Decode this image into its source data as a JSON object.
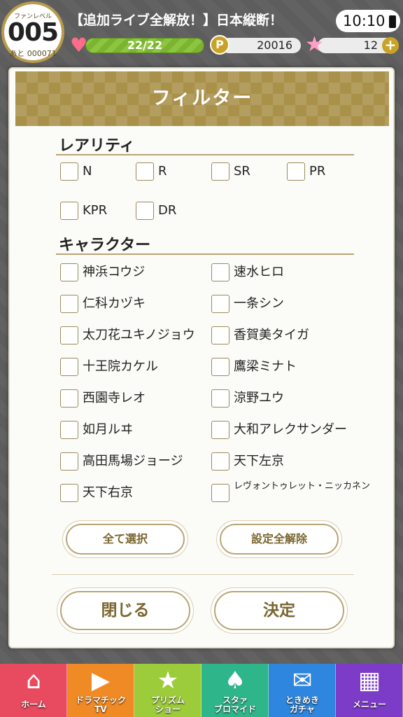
{
  "status_bar": {
    "fan_level_caption": "ファンレベル",
    "fan_level": "005",
    "next_level_remaining": "あと 000071",
    "news_ticker": "【追加ライブ全解放！】日本縦断！",
    "time": "10:10",
    "stamina": "22/22",
    "coins": "20016",
    "stars": "12",
    "coin_icon_letter": "P",
    "icons": {
      "stamina": "heart-icon",
      "coin": "coin-icon",
      "star": "star-icon",
      "add": "plus-icon",
      "battery": "battery-icon"
    }
  },
  "dialog": {
    "title": "フィルター",
    "rarity_section": {
      "title": "レアリティ",
      "options": [
        "N",
        "R",
        "SR",
        "PR",
        "KPR",
        "DR"
      ]
    },
    "character_section": {
      "title": "キャラクター",
      "left_column": [
        "神浜コウジ",
        "仁科カヅキ",
        "太刀花ユキノジョウ",
        "十王院カケル",
        "西園寺レオ",
        "如月ルヰ",
        "高田馬場ジョージ",
        "天下右京"
      ],
      "right_column": [
        "速水ヒロ",
        "一条シン",
        "香賀美タイガ",
        "鷹梁ミナト",
        "涼野ユウ",
        "大和アレクサンダー",
        "天下左京",
        "レヴォントゥレット・ニッカネン"
      ]
    },
    "select_all_label": "全て選択",
    "reset_label": "設定全解除",
    "close_label": "閉じる",
    "confirm_label": "決定"
  },
  "bottom_nav": [
    {
      "label": "ホーム",
      "icon": "home-icon"
    },
    {
      "label": "ドラマチック\nTV",
      "icon": "tv-icon"
    },
    {
      "label": "プリズム\nショー",
      "icon": "shooting-star-icon"
    },
    {
      "label": "スタァ\nブロマイド",
      "icon": "cards-icon"
    },
    {
      "label": "ときめき\nガチャ",
      "icon": "envelope-icon"
    },
    {
      "label": "メニュー",
      "icon": "grid-icon"
    }
  ],
  "colors": {
    "gold_header": "#a9914a",
    "gold_border": "#b8a574",
    "nav_home": "#e84a5f",
    "nav_tv": "#f08a24",
    "nav_prism": "#9ccc3a",
    "nav_bromide": "#2fb58a",
    "nav_gacha": "#2e86de",
    "nav_menu": "#7d3cc8"
  }
}
